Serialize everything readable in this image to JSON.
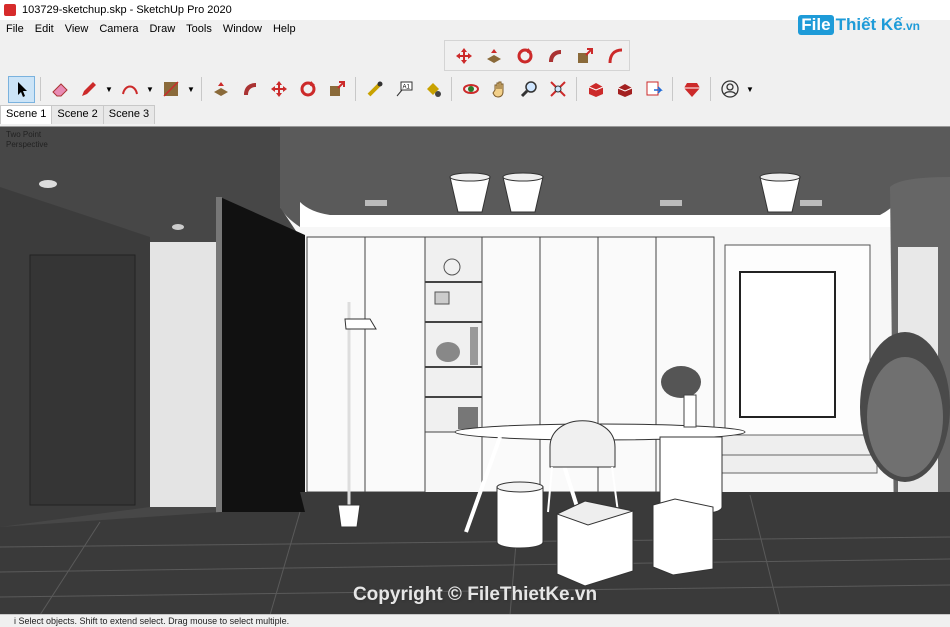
{
  "window": {
    "title": "103729-sketchup.skp - SketchUp Pro 2020"
  },
  "watermark": {
    "logo_tag": "File",
    "logo_text": "Thiết Kế",
    "logo_suffix": ".vn"
  },
  "menu": [
    "File",
    "Edit",
    "View",
    "Camera",
    "Draw",
    "Tools",
    "Window",
    "Help"
  ],
  "scenes": [
    "Scene 1",
    "Scene 2",
    "Scene 3"
  ],
  "viewport": {
    "projection_line1": "Two Point",
    "projection_line2": "Perspective"
  },
  "copyright": "Copyright © FileThietKe.vn",
  "status": {
    "text": "i   Select objects. Shift to extend select. Drag mouse to select multiple."
  },
  "colors": {
    "accent_red": "#cc2a2a",
    "select_blue": "#cce4f7",
    "wall_dark": "#4a4a4a",
    "floor": "#3a3a3a"
  },
  "toolbar_float_icons": [
    "move-icon",
    "push-pull-icon",
    "rotate-icon",
    "follow-me-icon",
    "scale-icon",
    "offset-icon"
  ],
  "toolbar_main_icons": [
    "select-icon",
    "eraser-icon",
    "pencil-icon",
    "arc-icon",
    "rectangle-icon",
    "push-pull-icon",
    "follow-me-icon",
    "move-icon",
    "rotate-icon",
    "scale-icon",
    "tape-measure-icon",
    "text-icon",
    "paint-bucket-icon",
    "orbit-icon",
    "pan-icon",
    "zoom-icon",
    "zoom-extents-icon",
    "warehouse-icon",
    "extension-warehouse-icon",
    "send-to-layout-icon",
    "ruby-icon",
    "account-icon"
  ]
}
